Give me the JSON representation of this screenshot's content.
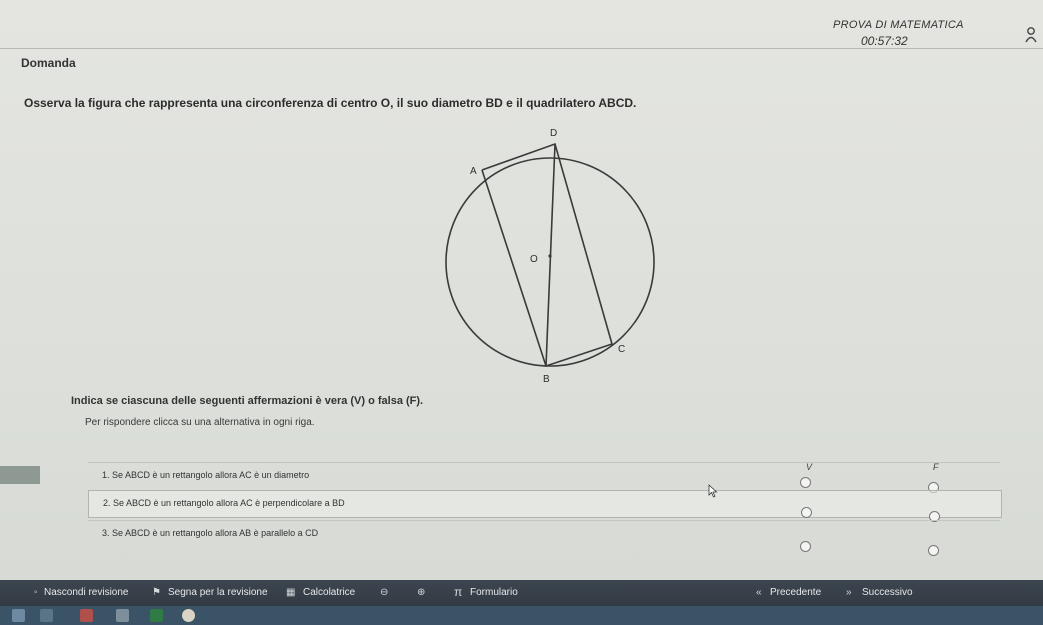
{
  "header": {
    "exam_title": "PROVA DI MATEMATICA",
    "timer": "00:57:32"
  },
  "section_label": "Domanda",
  "question": {
    "text": "Osserva la figura che rappresenta una circonferenza di centro O, il suo diametro BD e il quadrilatero ABCD."
  },
  "figure": {
    "labels": {
      "D": "D",
      "A": "A",
      "O": "O",
      "C": "C",
      "B": "B"
    }
  },
  "instructions": {
    "main": "Indica se ciascuna delle seguenti affermazioni è vera (V) o falsa (F).",
    "sub": "Per rispondere clicca su una alternativa in ogni riga."
  },
  "answers": {
    "col_v": "V",
    "col_f": "F",
    "rows": [
      {
        "label": "1. Se ABCD è un rettangolo allora AC è un diametro"
      },
      {
        "label": "2. Se ABCD è un rettangolo allora AC è perpendicolare a BD"
      },
      {
        "label": "3. Se ABCD è un rettangolo allora AB è parallelo a CD"
      }
    ]
  },
  "bottombar": {
    "hide_review": "Nascondi revisione",
    "mark_review": "Segna per la revisione",
    "calculator": "Calcolatrice",
    "formulary": "Formulario",
    "previous": "Precedente",
    "next": "Successivo"
  },
  "icons": {
    "user": "user-icon",
    "flag": "flag-icon",
    "calculator": "calculator-icon",
    "zoom_out": "zoom-out-icon",
    "zoom_in": "zoom-in-icon",
    "pi": "pi-icon",
    "previous": "double-chevron-left-icon",
    "next": "double-chevron-right-icon"
  },
  "colors": {
    "bottombar": "#36404a",
    "taskbar": "#3b5366"
  }
}
